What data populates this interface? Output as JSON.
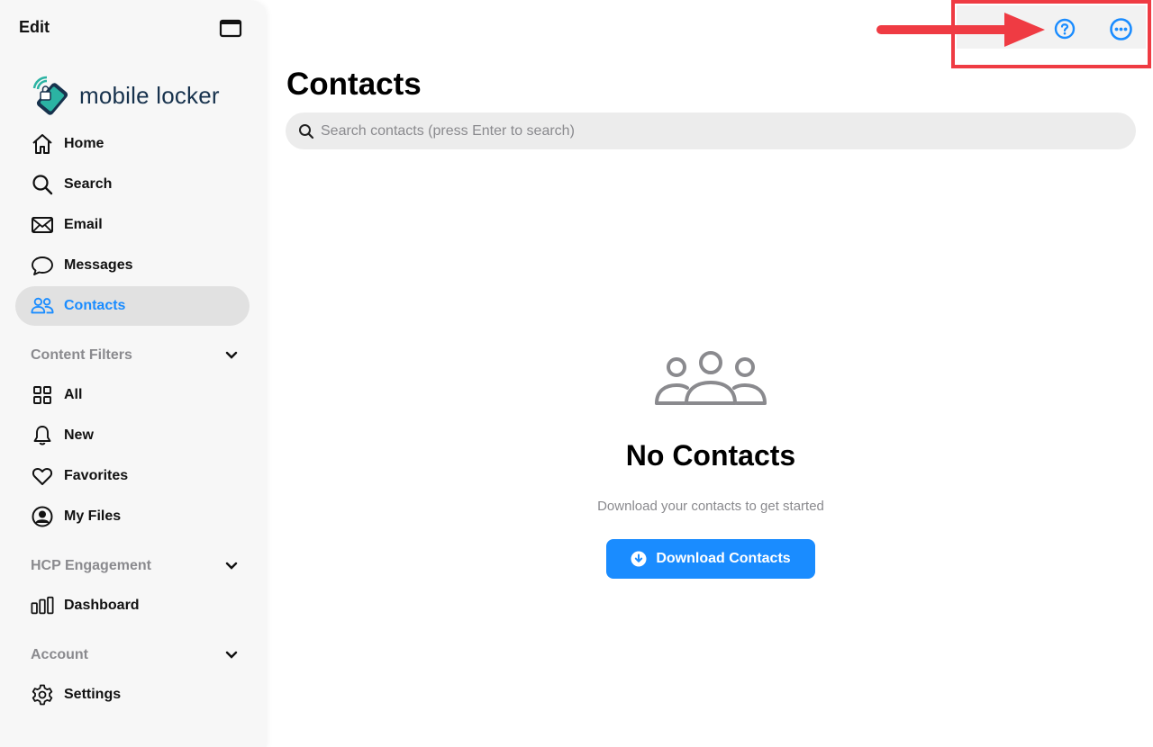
{
  "sidebar": {
    "edit_label": "Edit",
    "logo_text": "mobile locker",
    "nav": [
      {
        "label": "Home",
        "icon": "home-icon"
      },
      {
        "label": "Search",
        "icon": "search-icon"
      },
      {
        "label": "Email",
        "icon": "envelope-icon"
      },
      {
        "label": "Messages",
        "icon": "chat-bubble-icon"
      },
      {
        "label": "Contacts",
        "icon": "people-icon",
        "active": true
      }
    ],
    "sections": [
      {
        "label": "Content Filters",
        "items": [
          {
            "label": "All",
            "icon": "grid-icon"
          },
          {
            "label": "New",
            "icon": "bell-icon"
          },
          {
            "label": "Favorites",
            "icon": "heart-icon"
          },
          {
            "label": "My Files",
            "icon": "user-circle-icon"
          }
        ]
      },
      {
        "label": "HCP Engagement",
        "items": [
          {
            "label": "Dashboard",
            "icon": "bar-chart-icon"
          }
        ]
      },
      {
        "label": "Account",
        "items": [
          {
            "label": "Settings",
            "icon": "gear-icon"
          }
        ]
      }
    ]
  },
  "topbar": {
    "help_icon": "question-circle-icon",
    "more_icon": "ellipsis-circle-icon"
  },
  "main": {
    "title": "Contacts",
    "search_placeholder": "Search contacts (press Enter to search)",
    "empty_state": {
      "icon": "people-group-icon",
      "title": "No Contacts",
      "subtitle": "Download your contacts to get started",
      "button_label": "Download Contacts"
    }
  },
  "colors": {
    "accent": "#1a8cff",
    "annotation": "#ef3b43",
    "sidebar_bg": "#f7f7f7",
    "active_bg": "#e1e1e1",
    "muted_text": "#8a8a8e"
  }
}
